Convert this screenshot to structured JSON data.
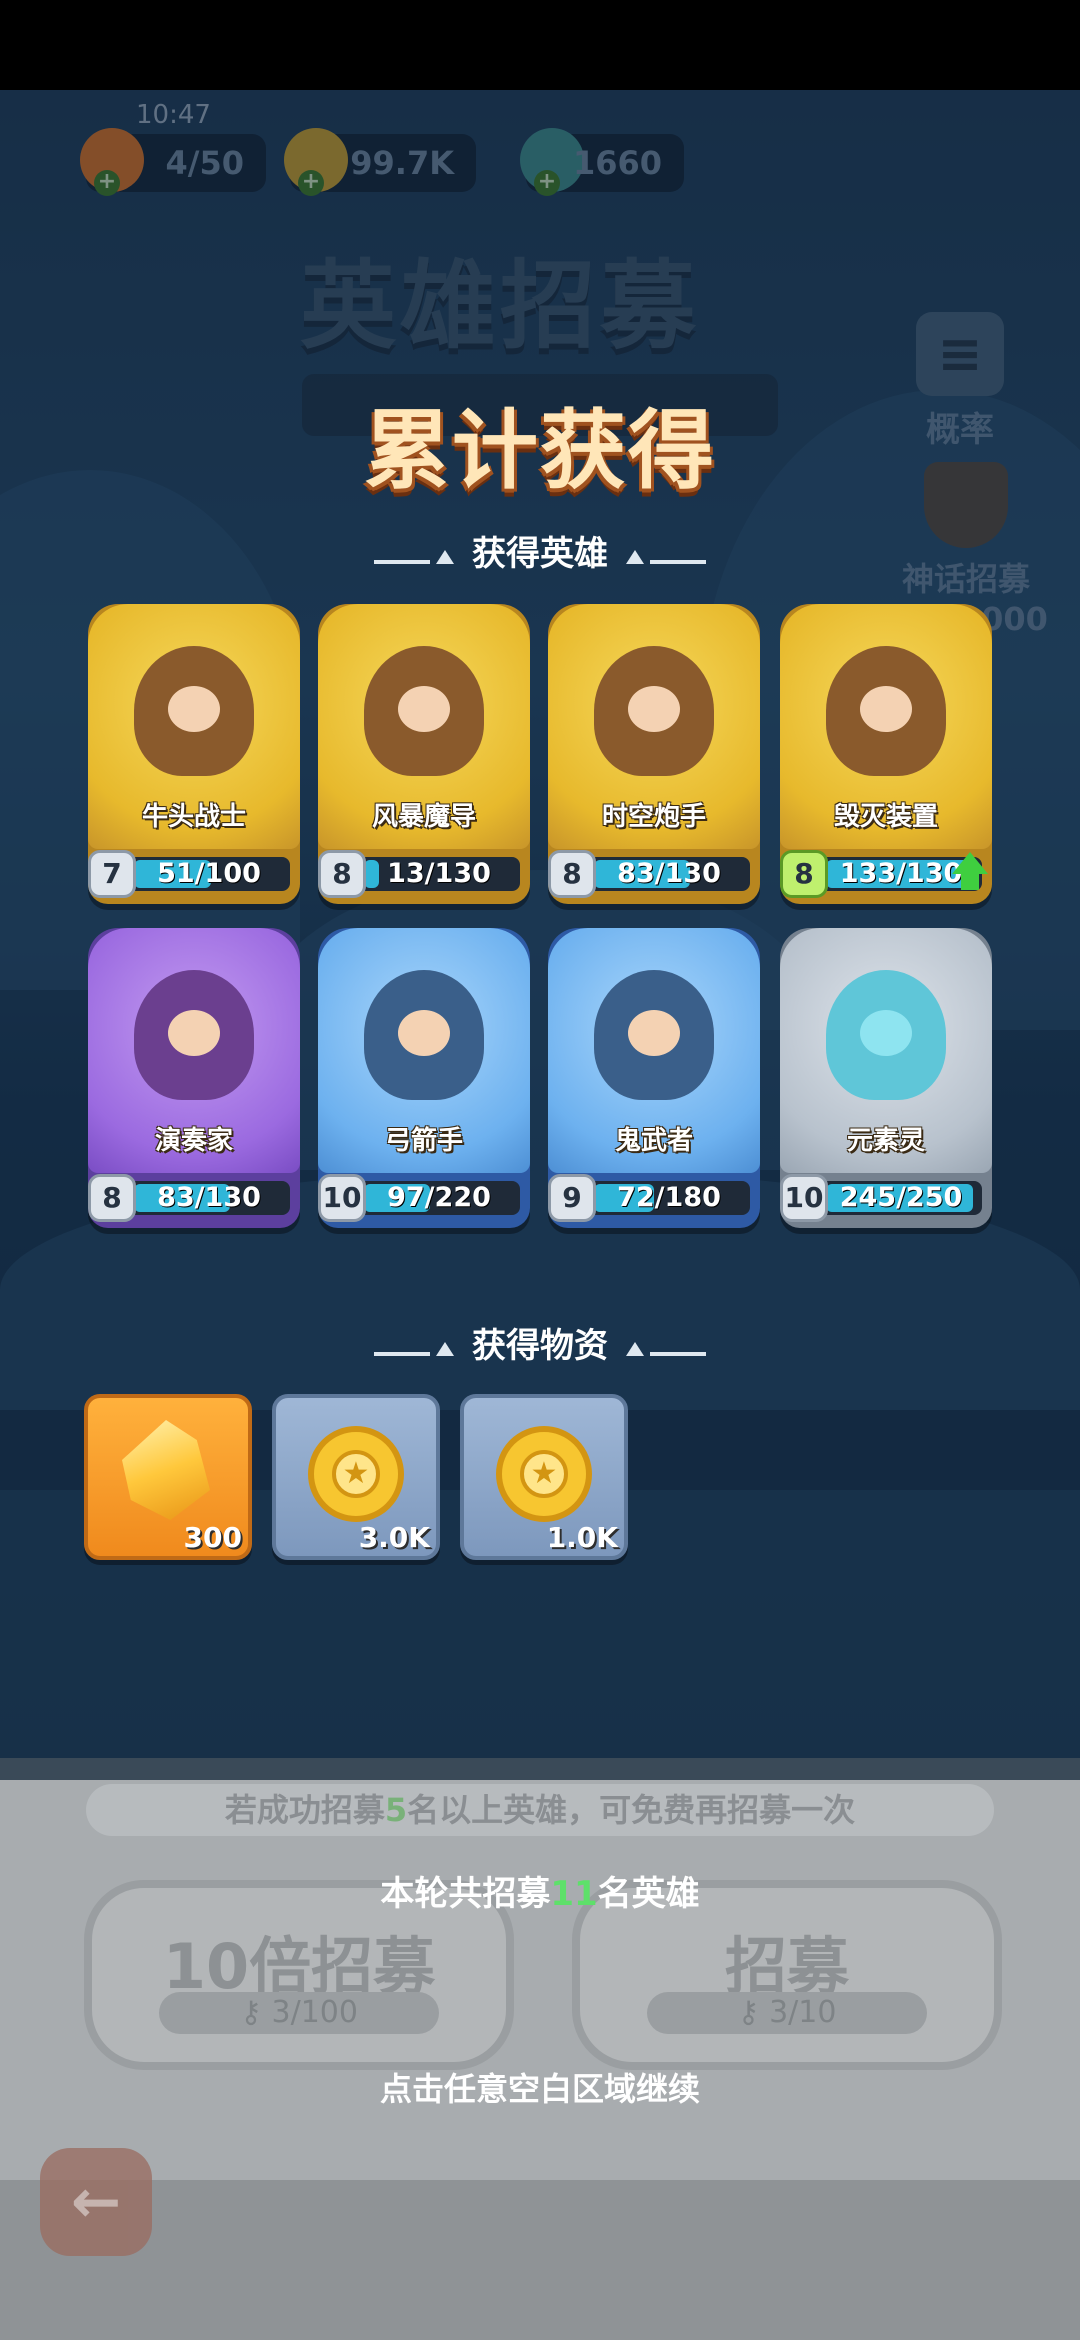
{
  "status": {
    "time": "10:47"
  },
  "resources": [
    {
      "name": "stamina",
      "icon": "fire-icon",
      "value": "4/50"
    },
    {
      "name": "gold",
      "icon": "coin-icon",
      "value": "99.7K"
    },
    {
      "name": "gems",
      "icon": "crystal-icon",
      "value": "1660"
    }
  ],
  "background": {
    "title": "英雄招募",
    "probability_label": "概率",
    "mythic_label": "神话招募",
    "mythic_progress": "?80/2000"
  },
  "result": {
    "title": "累计获得",
    "heroes_section": "获得英雄",
    "items_section": "获得物资"
  },
  "heroes": [
    {
      "name": "牛头战士",
      "level": "7",
      "progress": "51/100",
      "fill": 0.51,
      "rarity": "gold"
    },
    {
      "name": "风暴魔导",
      "level": "8",
      "progress": "13/130",
      "fill": 0.1,
      "rarity": "gold"
    },
    {
      "name": "时空炮手",
      "level": "8",
      "progress": "83/130",
      "fill": 0.64,
      "rarity": "gold"
    },
    {
      "name": "毁灭装置",
      "level": "8",
      "progress": "133/130",
      "fill": 1.0,
      "rarity": "gold",
      "upgradable": true
    },
    {
      "name": "演奏家",
      "level": "8",
      "progress": "83/130",
      "fill": 0.64,
      "rarity": "purple"
    },
    {
      "name": "弓箭手",
      "level": "10",
      "progress": "97/220",
      "fill": 0.44,
      "rarity": "blue"
    },
    {
      "name": "鬼武者",
      "level": "9",
      "progress": "72/180",
      "fill": 0.4,
      "rarity": "blue"
    },
    {
      "name": "元素灵",
      "level": "10",
      "progress": "245/250",
      "fill": 0.98,
      "rarity": "gray"
    }
  ],
  "items": [
    {
      "icon": "crystal-icon",
      "qty": "300",
      "style": "orange"
    },
    {
      "icon": "coin-icon",
      "qty": "3.0K",
      "style": "steel"
    },
    {
      "icon": "coin-icon",
      "qty": "1.0K",
      "style": "steel"
    }
  ],
  "footer": {
    "hint_pre": "若成功招募",
    "hint_num": "5",
    "hint_post": "名以上英雄，可免费再招募一次",
    "btn10_label": "10倍招募",
    "btn10_keys": "3/100",
    "btn1_label": "招募",
    "btn1_keys": "3/10",
    "summary_pre": "本轮共招募",
    "summary_num": "11",
    "summary_post": "名英雄",
    "continue": "点击任意空白区域继续"
  },
  "colors": {
    "accent_green": "#5ee06a",
    "bar_cyan": "#2fb6d8",
    "title_cream": "#ffe6b8"
  }
}
